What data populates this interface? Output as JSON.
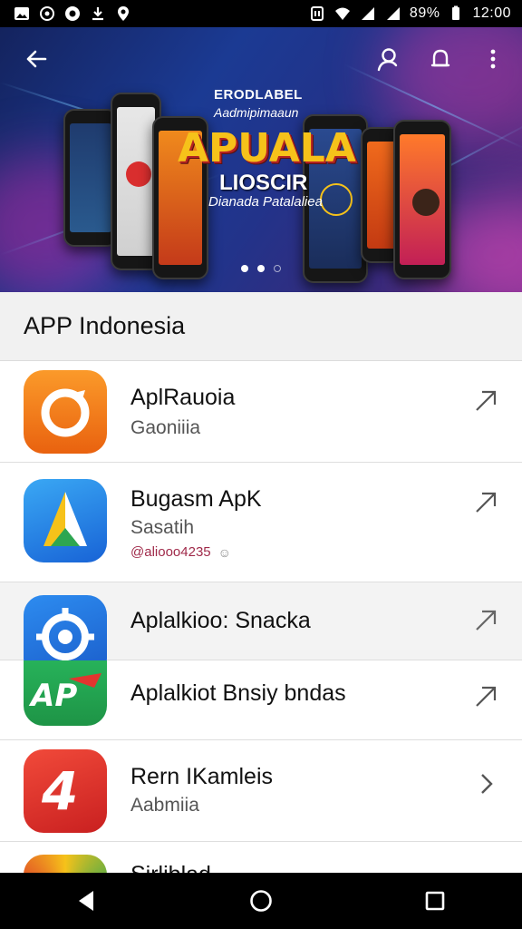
{
  "statusbar": {
    "left_icons": [
      "gallery-icon",
      "whatsapp-icon",
      "circle-app-icon",
      "download-icon",
      "location-icon"
    ],
    "battery": "89%",
    "time": "12:00"
  },
  "hero": {
    "brand_top": "ERODLABEL",
    "brand_sub": "Aadmipimaaun",
    "brand_main": "APUALA",
    "brand_line2": "LIOSCIR",
    "brand_line3": "Dianada Patalaliea",
    "slides_total": 3,
    "active_slide": 2
  },
  "section": {
    "title": "APP Indonesia"
  },
  "apps": [
    {
      "title": "AplRauoia",
      "subtitle": "Gaoniiia",
      "meta": "",
      "icon": "orange-ring-icon",
      "action": "open-external-icon"
    },
    {
      "title": "Bugasm ApK",
      "subtitle": "Sasatih",
      "meta": "@aliooo4235",
      "icon": "blue-arrow-icon",
      "action": "open-external-icon"
    },
    {
      "title": "Aplalkioo: Snacka",
      "subtitle": "",
      "meta": "",
      "icon": "blue-gear-icon",
      "action": "open-external-icon"
    },
    {
      "title": "Aplalkiot Bnsiy bndas",
      "subtitle": "",
      "meta": "",
      "icon": "green-ap-icon",
      "action": "open-external-icon"
    },
    {
      "title": "Rern IKamleis",
      "subtitle": "Aabmiia",
      "meta": "",
      "icon": "red-four-icon",
      "action": "chevron-right-icon"
    },
    {
      "title": "Sirliblad",
      "subtitle": "",
      "meta": "",
      "icon": "rainbow-icon",
      "action": ""
    }
  ],
  "colors": {
    "accent_orange": "#f07a16",
    "accent_blue": "#1e7be0",
    "accent_green": "#23a553",
    "accent_red": "#dc2f2a",
    "hero_bg": "#1b3a93"
  }
}
